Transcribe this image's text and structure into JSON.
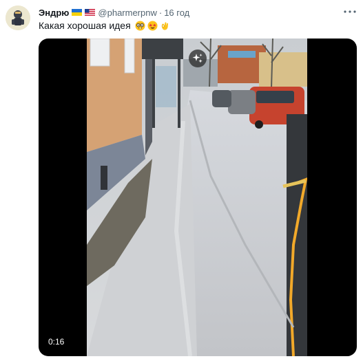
{
  "tweet": {
    "author_name": "Эндрю",
    "author_flags": [
      "ukraine-flag",
      "usa-flag"
    ],
    "handle": "@pharmerpnw",
    "separator": "·",
    "time": "16 год",
    "text": "Какая хорошая идея",
    "text_emojis": [
      "nerd-face-emoji",
      "star-struck-emoji",
      "ok-hand-emoji"
    ],
    "more_icon": "more-options-icon"
  },
  "media": {
    "type": "video",
    "duration": "0:16",
    "overlay_icon": "sparkle-icon"
  },
  "colors": {
    "text_primary": "#0f1419",
    "text_secondary": "#536471",
    "media_background": "#000000"
  }
}
